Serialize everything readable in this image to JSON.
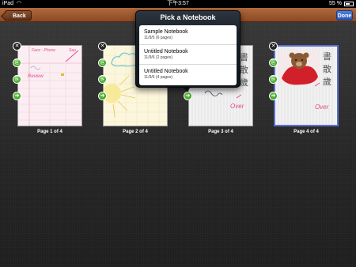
{
  "status": {
    "device": "iPad",
    "time": "下午3:57",
    "battery": "55 %"
  },
  "toolbar": {
    "back_label": "Back",
    "done_label": "Done"
  },
  "popover": {
    "title": "Pick a Notebook",
    "notebooks": [
      {
        "name": "Sample Notebook",
        "meta": "11/9/5 (6 pages)"
      },
      {
        "name": "Untitled Notebook",
        "meta": "11/9/6 (2 pages)"
      },
      {
        "name": "Untitled Notebook",
        "meta": "11/9/6 (4 pages)"
      }
    ]
  },
  "pages": [
    {
      "caption": "Page 1 of 4",
      "handwriting": [
        "Face - Phone",
        "Sep",
        "Review"
      ]
    },
    {
      "caption": "Page 2 of 4"
    },
    {
      "caption": "Page 3 of 4",
      "handwriting": [
        "書",
        "散",
        "歲",
        "Over"
      ]
    },
    {
      "caption": "Page 4 of 4",
      "handwriting": [
        "書",
        "散",
        "歲",
        "Over"
      ]
    }
  ],
  "colors": {
    "toolbar": "#9a5a31",
    "done": "#2f63c8",
    "selected_border": "#5a6fd0"
  }
}
